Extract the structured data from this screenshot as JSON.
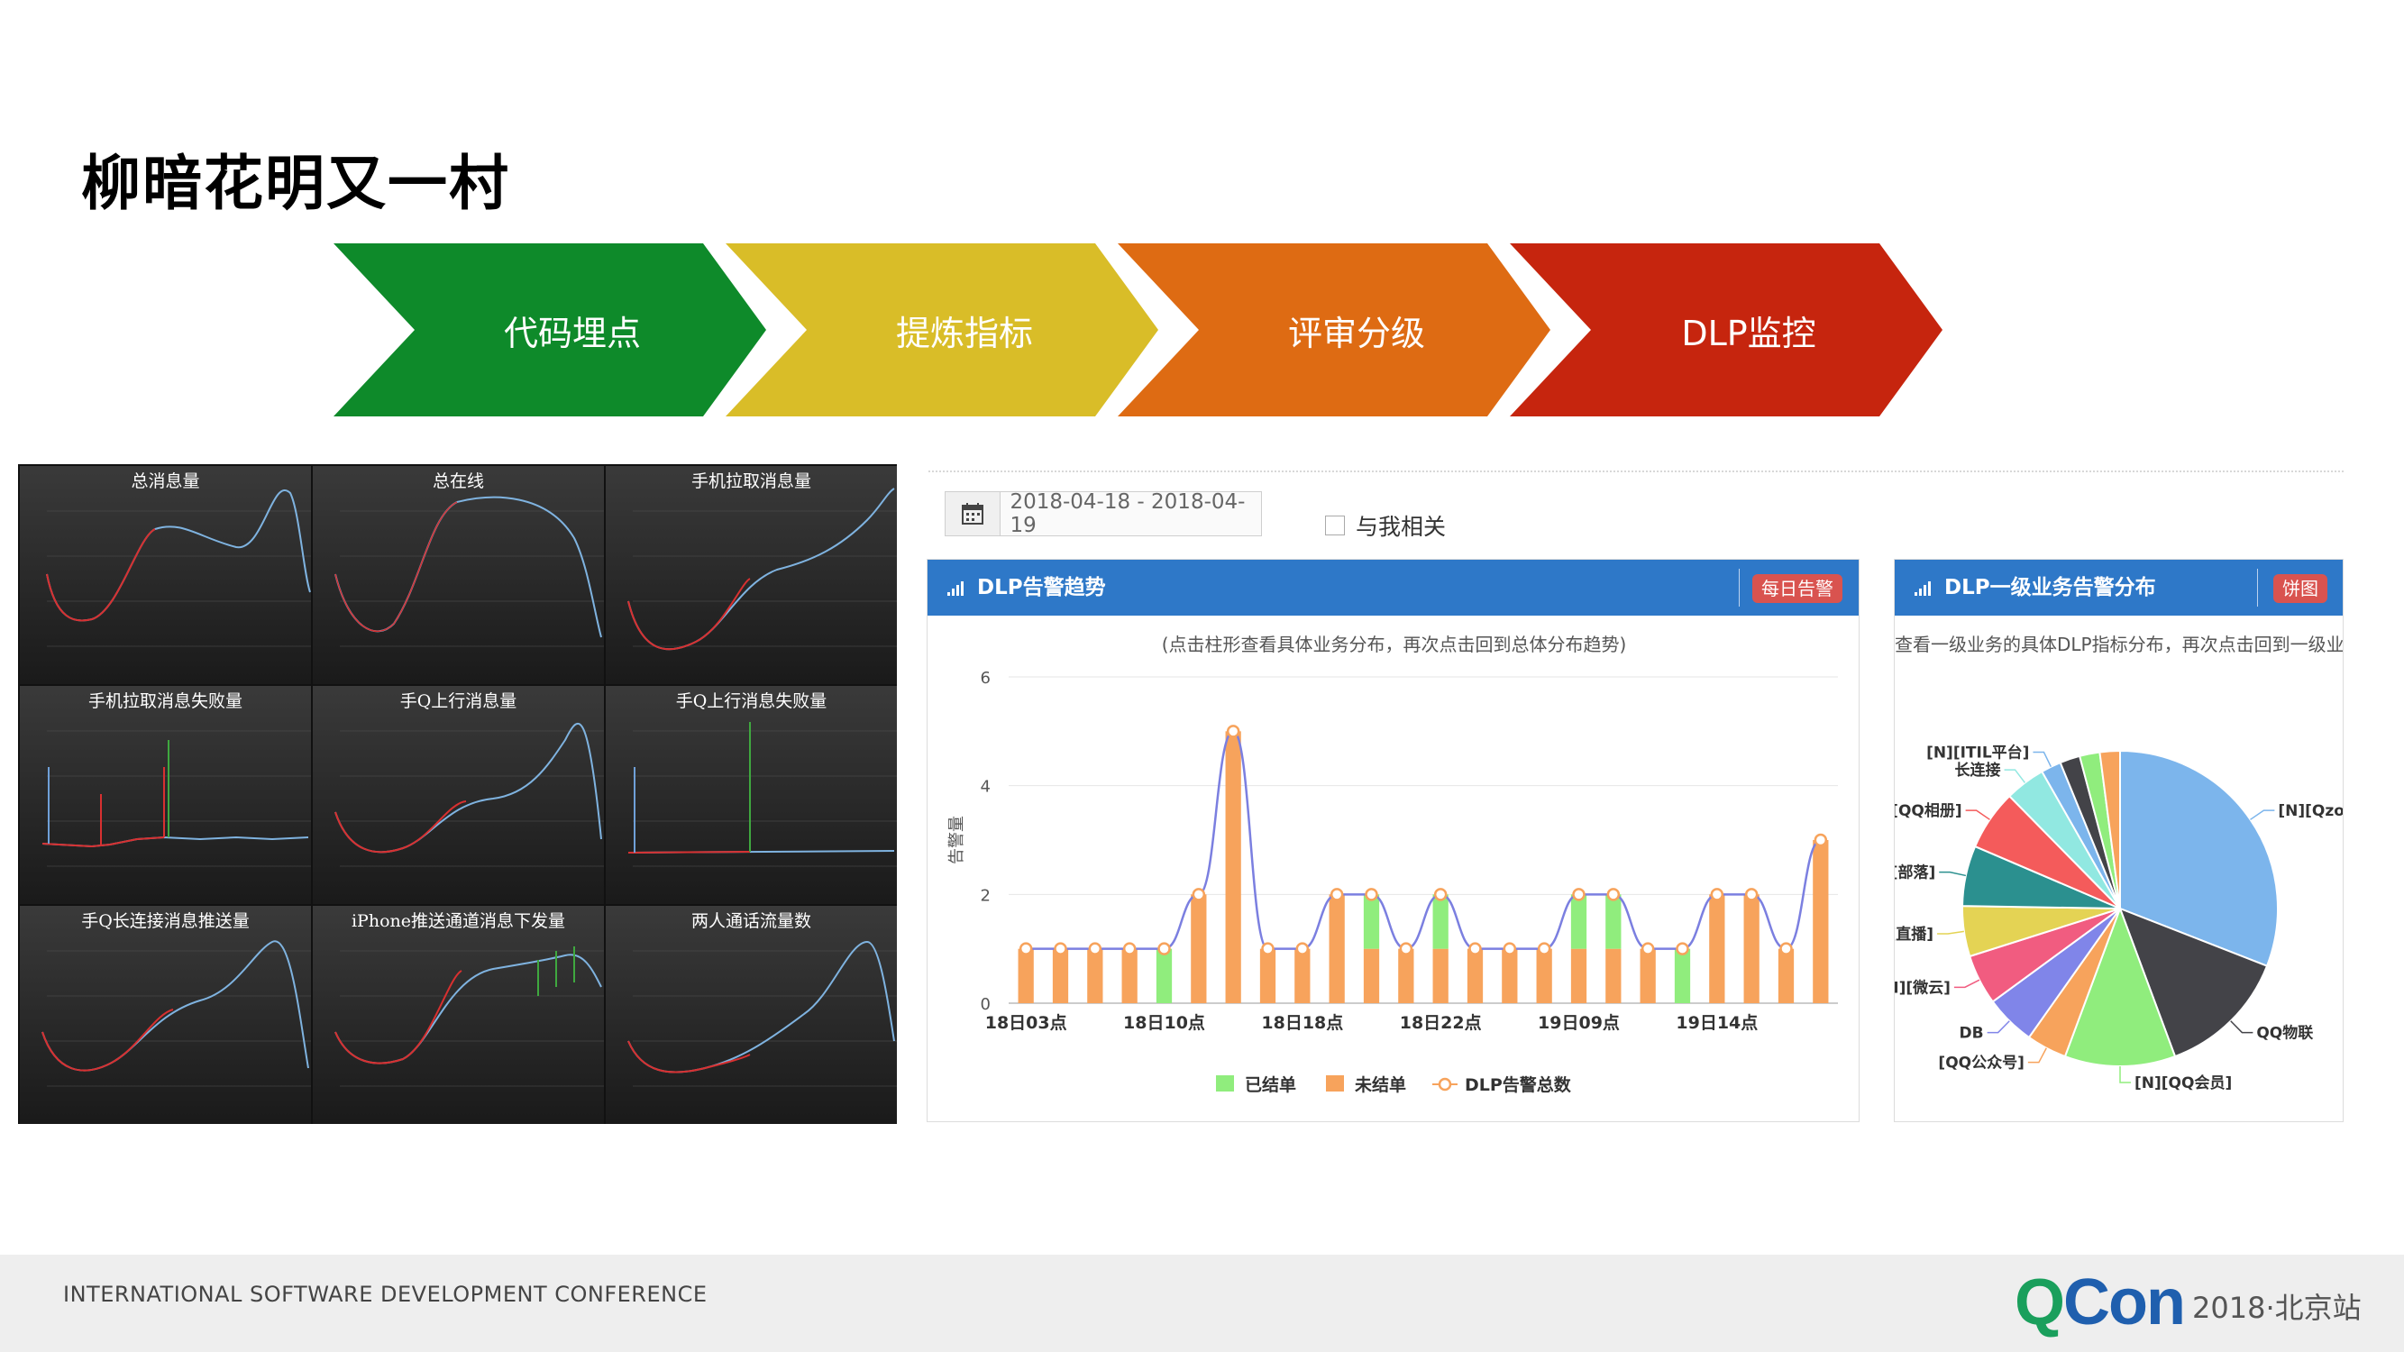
{
  "slide": {
    "title": "柳暗花明又一村"
  },
  "steps": [
    {
      "label": "代码埋点",
      "color": "#0e8a2a"
    },
    {
      "label": "提炼指标",
      "color": "#d9bd28"
    },
    {
      "label": "评审分级",
      "color": "#de6b13"
    },
    {
      "label": "DLP监控",
      "color": "#c6250e"
    }
  ],
  "thumbnails": [
    {
      "title": "总消息量"
    },
    {
      "title": "总在线"
    },
    {
      "title": "手机拉取消息量"
    },
    {
      "title": "手机拉取消息失败量"
    },
    {
      "title": "手Q上行消息量"
    },
    {
      "title": "手Q上行消息失败量"
    },
    {
      "title": "手Q长连接消息推送量"
    },
    {
      "title": "iPhone推送通道消息下发量"
    },
    {
      "title": "两人通话流量数"
    }
  ],
  "filters": {
    "date_range": "2018-04-18 - 2018-04-19",
    "related_label": "与我相关"
  },
  "trend_panel": {
    "title": "DLP告警趋势",
    "badge": "每日告警",
    "subtitle": "(点击柱形查看具体业务分布，再次点击回到总体分布趋势)"
  },
  "pie_panel": {
    "title": "DLP一级业务告警分布",
    "badge": "饼图",
    "subtitle": "查看一级业务的具体DLP指标分布，再次点击回到一级业务"
  },
  "chart_data": [
    {
      "type": "bar",
      "ylabel": "告警量",
      "ylim": [
        0,
        6
      ],
      "yticks": [
        0,
        2,
        4,
        6
      ],
      "x_tick_labels": [
        {
          "label": "18日03点",
          "index": 0
        },
        {
          "label": "18日10点",
          "index": 4
        },
        {
          "label": "18日18点",
          "index": 8
        },
        {
          "label": "18日22点",
          "index": 12
        },
        {
          "label": "19日09点",
          "index": 16
        },
        {
          "label": "19日14点",
          "index": 20
        }
      ],
      "series": [
        {
          "name": "已结单",
          "color": "#90ed7d",
          "values": [
            0,
            0,
            0,
            0,
            1,
            0,
            0,
            0,
            0,
            0,
            1,
            0,
            1,
            0,
            0,
            0,
            1,
            1,
            0,
            1,
            0,
            0,
            0,
            0
          ]
        },
        {
          "name": "未结单",
          "color": "#f7a35c",
          "values": [
            1,
            1,
            1,
            1,
            0,
            2,
            5,
            1,
            1,
            2,
            1,
            1,
            1,
            1,
            1,
            1,
            1,
            1,
            1,
            0,
            2,
            2,
            1,
            3
          ]
        },
        {
          "name": "DLP告警总数",
          "color": "#7b7fe0",
          "values": [
            1,
            1,
            1,
            1,
            1,
            2,
            5,
            1,
            1,
            2,
            2,
            1,
            2,
            1,
            1,
            1,
            2,
            2,
            1,
            1,
            2,
            2,
            1,
            3
          ]
        }
      ],
      "legend": "bottom"
    },
    {
      "type": "pie",
      "labels": [
        "[N][Qzone]",
        "QQ物联",
        "[N][QQ会员]",
        "[QQ公众号]",
        "DB",
        "[N][微云]",
        "[直播]",
        "[部落]",
        "[QQ相册]",
        "长连接",
        "[N][ITIL平台]",
        "",
        "",
        ""
      ],
      "values": [
        30,
        13,
        11,
        4,
        5,
        5,
        5,
        6,
        6,
        4,
        2,
        2,
        2,
        2
      ],
      "colors": [
        "#7cb5ec",
        "#434348",
        "#90ed7d",
        "#f7a35c",
        "#8085e9",
        "#f15c80",
        "#e4d354",
        "#2b908f",
        "#f45b5b",
        "#91e8e1",
        "#7cb5ec",
        "#434348",
        "#90ed7d",
        "#f7a35c"
      ]
    }
  ],
  "footer": {
    "conference": "INTERNATIONAL SOFTWARE DEVELOPMENT CONFERENCE",
    "logo_q": "Q",
    "logo_con": "Con",
    "edition": "2018·北京站"
  }
}
